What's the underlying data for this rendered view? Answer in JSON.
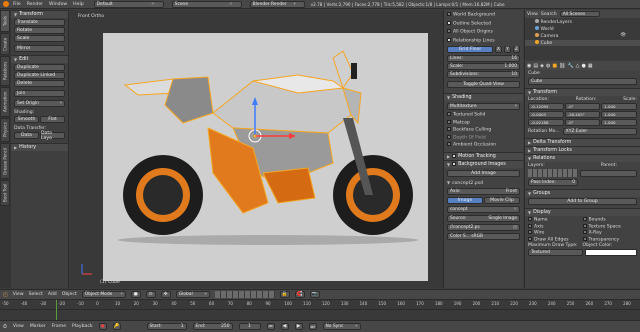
{
  "topbar": {
    "menus": [
      "File",
      "Render",
      "Window",
      "Help"
    ],
    "layout": "Default",
    "scene": "Scene",
    "engine": "Blender Render",
    "stats": "v2.78 | Verts:2,790 | Faces:2,778 | Tris:5,582 | Objects:1/8 | Lamps:0/1 | Mem:16.82M | Cube"
  },
  "left_tabs": [
    "Tools",
    "Create",
    "Relations",
    "Animation",
    "Physics",
    "Grease Pencil",
    "Boot Tool"
  ],
  "toolshelf": {
    "transform_header": "Transform",
    "transform_items": [
      "Translate",
      "Rotate",
      "Scale",
      "Mirror"
    ],
    "edit_header": "Edit",
    "edit_items": [
      "Duplicate",
      "Duplicate Linked",
      "Delete",
      "Join"
    ],
    "set_origin": "Set Origin",
    "shading_label": "Shading:",
    "smooth": "Smooth",
    "flat": "Flat",
    "data_transfer_label": "Data Transfer:",
    "data": "Data",
    "data_layo": "Data Layo",
    "history_header": "History"
  },
  "viewport": {
    "view_label": "Front Ortho",
    "object_label": "(1) Cube",
    "bottom_menus": [
      "View",
      "Select",
      "Add",
      "Object"
    ],
    "mode": "Object Mode",
    "pivot": "Global"
  },
  "npanel": {
    "world_background": "World Background",
    "outline_selected": "Outline Selected",
    "all_object_origins": "All Object Origins",
    "relationship_lines": "Relationship Lines",
    "grid_floor": "Grid Floor",
    "lines_label": "Lines:",
    "lines_value": "16",
    "scale_label": "Scale:",
    "scale_value": "1.000",
    "subdiv_label": "Subdivisions:",
    "subdiv_value": "10",
    "toggle_quad_view": "Toggle Quad View",
    "shading_header": "Shading",
    "shading_mode": "Multitexture",
    "shading_options": [
      "Textured Solid",
      "Matcap",
      "Backface Culling",
      "Depth Of Field",
      "Ambient Occlusion"
    ],
    "motion_tracking": "Motion Tracking",
    "background_images": "Background Images",
    "add_image": "Add Image",
    "image_name": "concept2.psd",
    "axis_label": "Axis:",
    "axis_value": "Front",
    "image_tab": "Image",
    "movie_clip_tab": "Movie Clip",
    "concept_name": "concept",
    "source_label": "Source:",
    "source_value": "Single Image",
    "concept_file": "//concept2.ps",
    "color_space": "Color S... sRGB"
  },
  "outliner": {
    "view": "View",
    "search": "Search",
    "all_scenes": "All Scenes",
    "items": [
      "RenderLayers",
      "World",
      "Camera",
      "Cube"
    ]
  },
  "properties": {
    "object_name": "Cube",
    "breadcrumb": "Cube",
    "transform_header": "Transform",
    "location_label": "Location:",
    "rotation_label": "Rotation:",
    "scale_label": "Scale:",
    "location": [
      "-0.12095",
      "-0.0003",
      "-0.02188"
    ],
    "rotation": [
      "-0°",
      "-26.405°",
      "-0°"
    ],
    "scale": [
      "1.000",
      "1.000",
      "1.000"
    ],
    "rotation_mode_label": "Rotation Mo...",
    "rotation_mode_value": "XYZ Euler",
    "delta_transform": "Delta Transform",
    "transform_locks": "Transform Locks",
    "relations_header": "Relations",
    "layers_label": "Layers:",
    "parent_label": "Parent:",
    "pass_index_label": "Pass Index:",
    "pass_index_value": "0",
    "groups_header": "Groups",
    "add_to_group": "Add to Group",
    "display_header": "Display",
    "display_opts_left": [
      "Name",
      "Axis",
      "Wire",
      "Draw All Edges"
    ],
    "display_opts_right": [
      "Bounds",
      "Texture Space",
      "X-Ray",
      "Transparency"
    ],
    "max_draw_type_label": "Maximum Draw Type:",
    "max_draw_type_value": "Textured",
    "object_color_label": "Object Color:"
  },
  "timeline": {
    "ruler_numbers": [
      "-50",
      "-40",
      "-30",
      "-20",
      "-10",
      "0",
      "10",
      "20",
      "30",
      "40",
      "50",
      "60",
      "70",
      "80",
      "90",
      "100",
      "110",
      "120",
      "130",
      "140",
      "150",
      "160",
      "170",
      "180",
      "190",
      "200",
      "210",
      "220",
      "230",
      "240",
      "250",
      "260",
      "270",
      "280"
    ],
    "menus": [
      "View",
      "Marker",
      "Frame",
      "Playback"
    ],
    "start_label": "Start:",
    "start_value": "1",
    "end_label": "End:",
    "end_value": "250",
    "current_frame": "1",
    "sync": "No Sync"
  },
  "colors": {
    "bike_orange": "#e07a1c",
    "bike_grey": "#c8c8c8",
    "selection": "#f5a623",
    "accent_blue": "#5680c2"
  }
}
